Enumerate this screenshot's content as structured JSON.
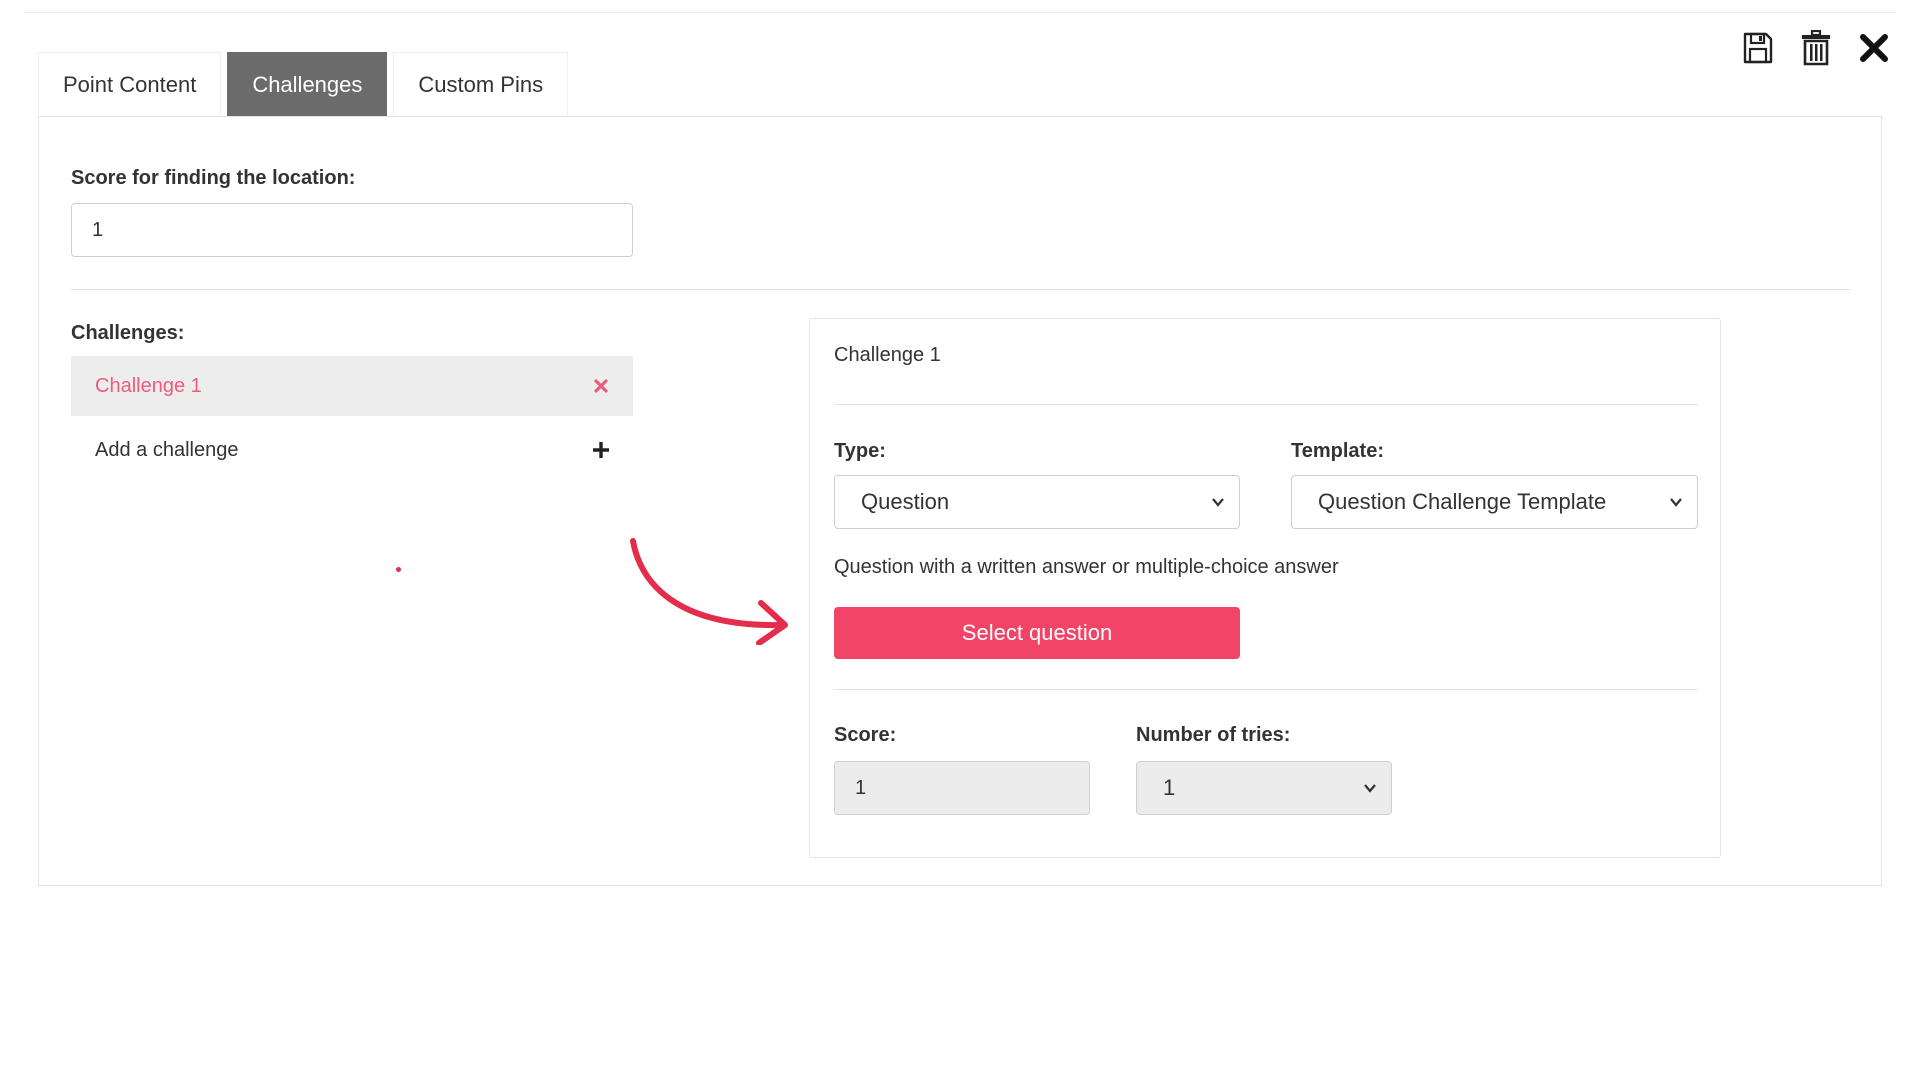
{
  "toolbar": {
    "save_icon": "floppy-disk-icon",
    "delete_icon": "trash-icon",
    "close_icon": "close-x-icon"
  },
  "tabs": [
    {
      "label": "Point Content",
      "active": false
    },
    {
      "label": "Challenges",
      "active": true
    },
    {
      "label": "Custom Pins",
      "active": false
    }
  ],
  "score_location": {
    "label": "Score for finding the location:",
    "value": "1"
  },
  "challenges": {
    "label": "Challenges:",
    "items": [
      {
        "label": "Challenge 1",
        "selected": true
      }
    ],
    "add_label": "Add a challenge"
  },
  "detail": {
    "title": "Challenge 1",
    "type_label": "Type:",
    "type_value": "Question",
    "template_label": "Template:",
    "template_value": "Question Challenge Template",
    "description": "Question with a written answer or multiple-choice answer",
    "select_button": "Select question",
    "score_label": "Score:",
    "score_value": "1",
    "tries_label": "Number of tries:",
    "tries_value": "1"
  },
  "colors": {
    "accent": "#f24466",
    "selected_text": "#ee5c7b",
    "active_tab": "#6b6b6b",
    "arrow": "#e32d4a"
  }
}
